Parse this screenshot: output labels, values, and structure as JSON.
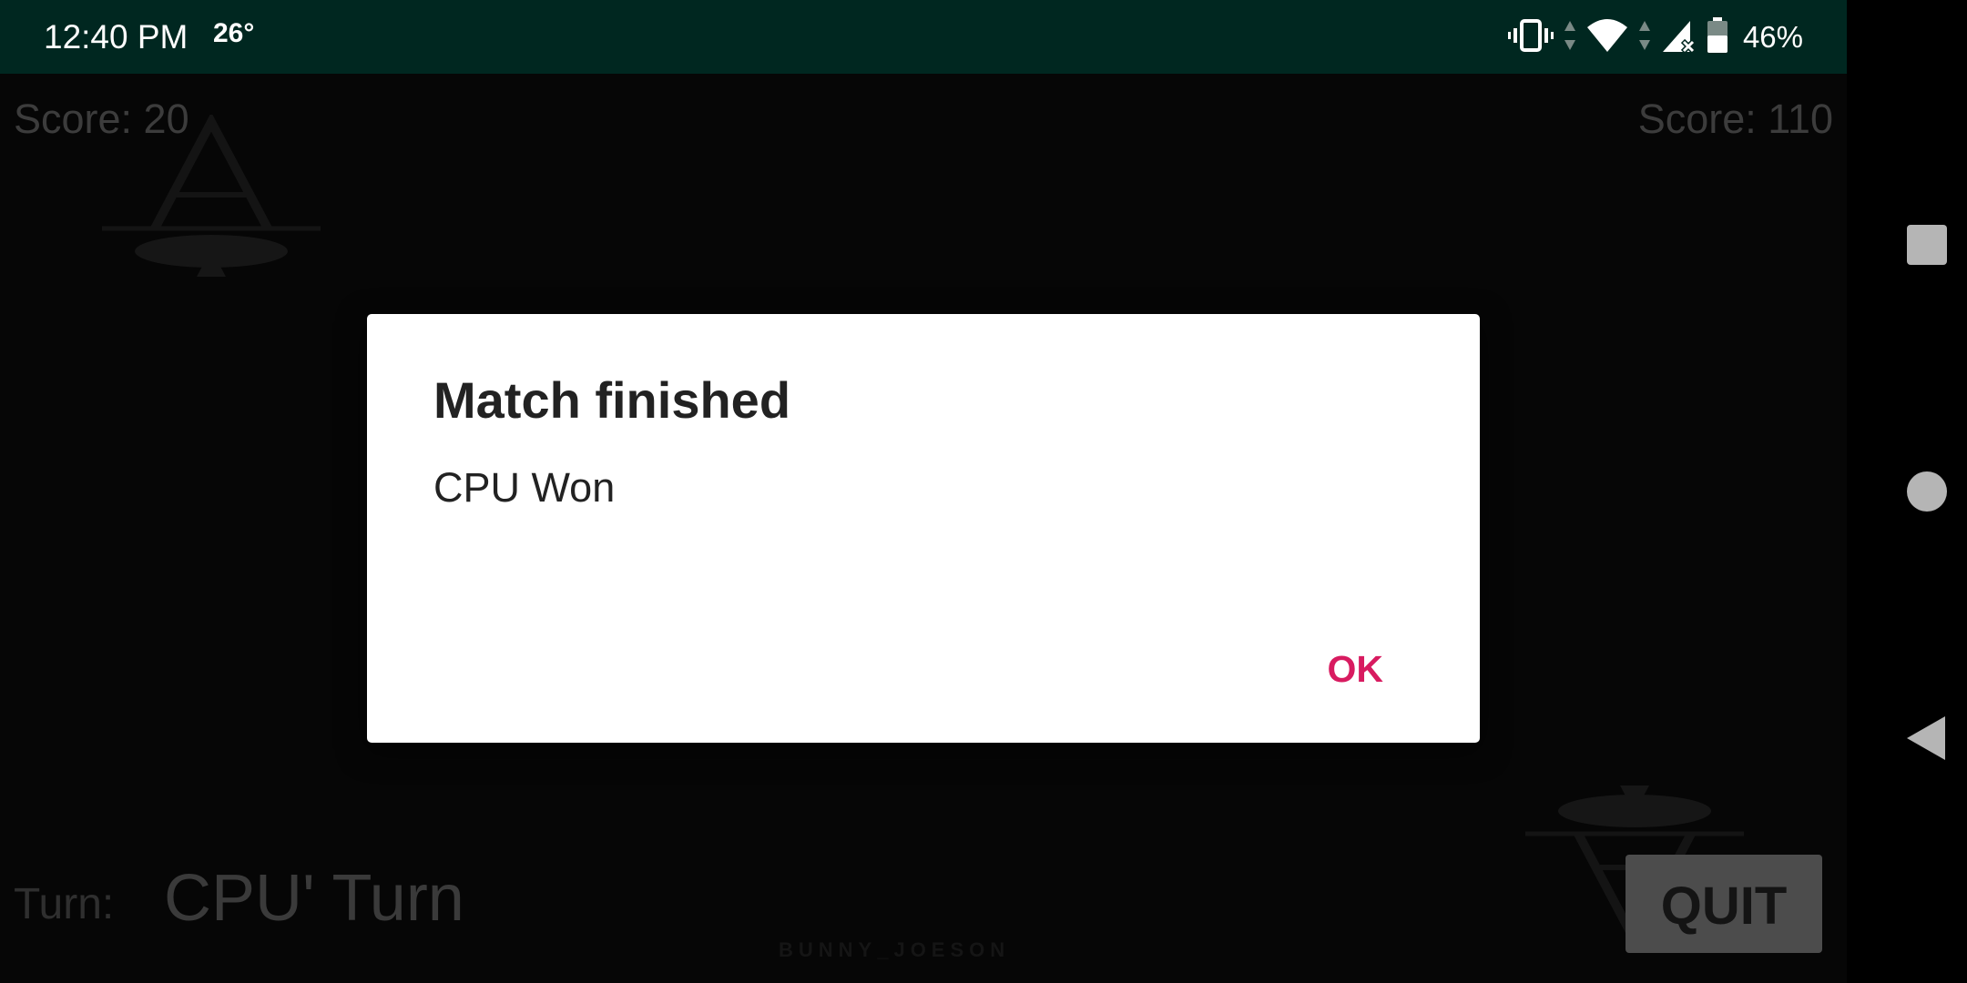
{
  "status_bar": {
    "time": "12:40 PM",
    "temperature": "26°",
    "battery": "46%",
    "icons": [
      "vibrate-icon",
      "data-arrows-icon",
      "wifi-icon",
      "signal-no-sim-icon",
      "battery-icon"
    ],
    "background": "#002720"
  },
  "game": {
    "player_score": "Score: 20",
    "cpu_score": "Score: 110",
    "turn_label": "Turn:",
    "turn_value": "CPU' Turn",
    "watermark": "BUNNY_JOESON",
    "quit_label": "QUIT"
  },
  "dialog": {
    "title": "Match finished",
    "message": "CPU Won",
    "ok_label": "OK",
    "accent_color": "#d81b60"
  },
  "nav_bar": {
    "buttons": [
      "recents-icon",
      "home-icon",
      "back-icon"
    ]
  }
}
